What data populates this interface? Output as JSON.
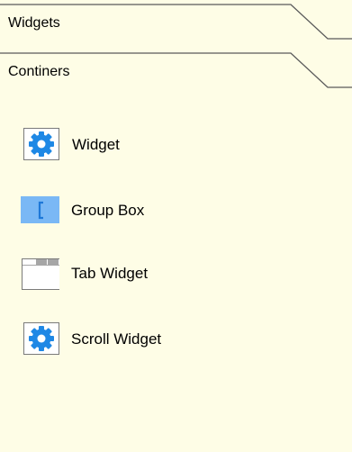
{
  "categories": [
    {
      "label": "Widgets"
    },
    {
      "label": "Continers"
    }
  ],
  "items": [
    {
      "label": "Widget",
      "icon": "gear-icon"
    },
    {
      "label": "Group Box",
      "icon": "group-box-icon"
    },
    {
      "label": "Tab Widget",
      "icon": "tab-widget-icon"
    },
    {
      "label": "Scroll Widget",
      "icon": "gear-icon"
    }
  ],
  "colors": {
    "background": "#fefde6",
    "icon_blue": "#1e88e5",
    "icon_light_blue": "#7ab8f5",
    "tab_gray": "#a6a6a6",
    "separator": "#8a8a8a"
  }
}
